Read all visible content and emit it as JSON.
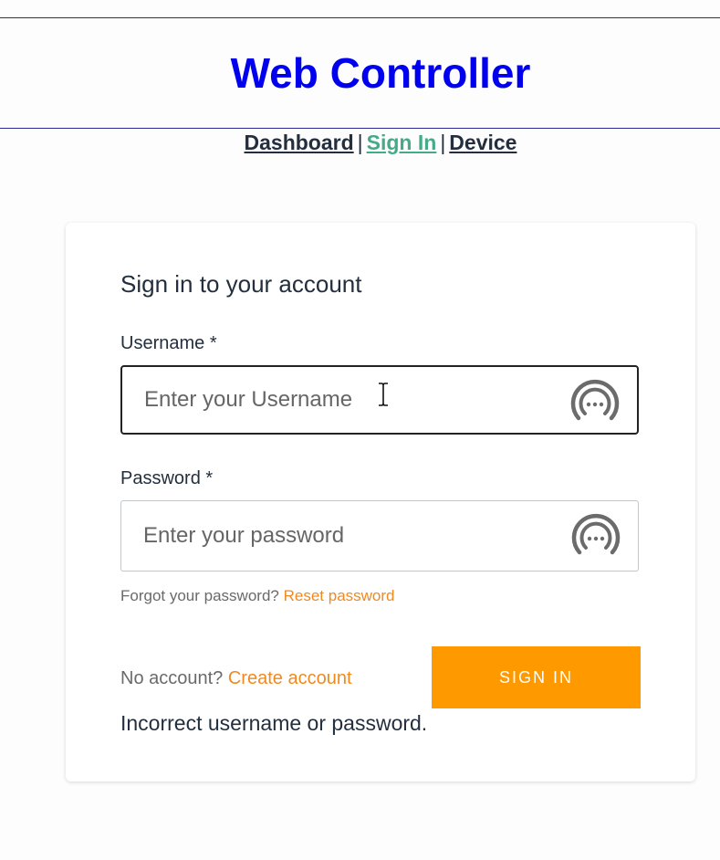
{
  "header": {
    "title": "Web Controller"
  },
  "nav": {
    "items": [
      {
        "label": "Dashboard",
        "active": false
      },
      {
        "label": "Sign In",
        "active": true
      },
      {
        "label": "Device",
        "active": false
      }
    ],
    "separator": "|"
  },
  "signin": {
    "title": "Sign in to your account",
    "username": {
      "label": "Username *",
      "placeholder": "Enter your Username",
      "value": ""
    },
    "password": {
      "label": "Password *",
      "placeholder": "Enter your password",
      "value": ""
    },
    "forgot_text": "Forgot your password?",
    "reset_link": "Reset password",
    "no_account_text": "No account?",
    "create_account_link": "Create account",
    "submit_label": "SIGN IN",
    "error_message": "Incorrect username or password.",
    "password_manager_icon": "password-manager-icon"
  },
  "colors": {
    "title": "#0000ee",
    "nav_text": "#232f3e",
    "nav_active": "#44aa88",
    "accent": "#ff9900",
    "link": "#f08a1e"
  }
}
